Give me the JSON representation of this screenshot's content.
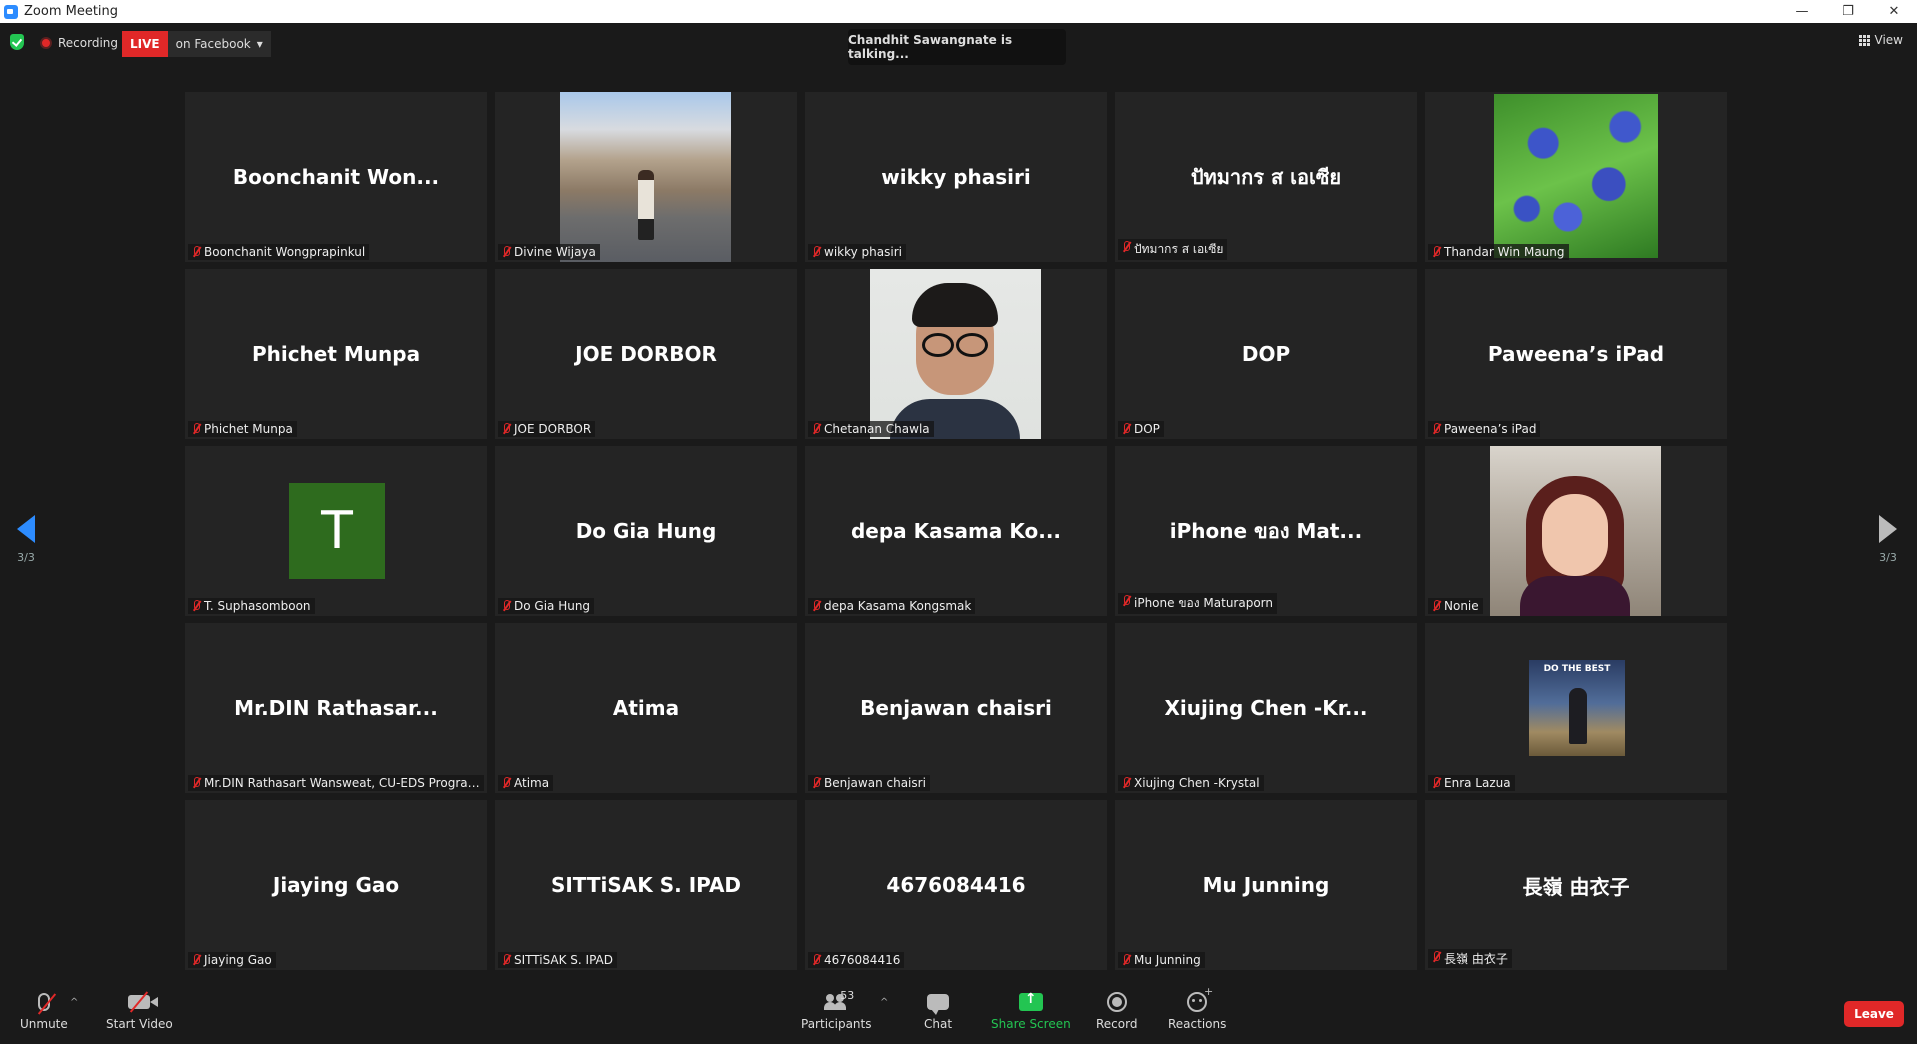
{
  "window": {
    "title": "Zoom Meeting",
    "controls": [
      "—",
      "❐",
      "✕"
    ]
  },
  "topbar": {
    "recording_label": "Recording",
    "live_label": "LIVE",
    "live_destination": "on Facebook",
    "talking": "Chandhit Sawangnate is talking...",
    "view_label": "View"
  },
  "pagination": {
    "left": "3/3",
    "right": "3/3"
  },
  "tiles": [
    {
      "display": "Boonchanit  Won...",
      "label": "Boonchanit Wongprapinkul",
      "type": "name"
    },
    {
      "display": "",
      "label": "Divine Wijaya",
      "type": "photo",
      "photo": "pic-prague"
    },
    {
      "display": "wikky phasiri",
      "label": "wikky phasiri",
      "type": "name"
    },
    {
      "display": "ปัทมากร   ส เอเซีย",
      "label": "ปัทมากร   ส เอเซีย",
      "type": "name"
    },
    {
      "display": "",
      "label": "Thandar Win Maung",
      "type": "photo",
      "photo": "pic-flowers"
    },
    {
      "display": "Phichet Munpa",
      "label": "Phichet Munpa",
      "type": "name"
    },
    {
      "display": "JOE DORBOR",
      "label": "JOE DORBOR",
      "type": "name"
    },
    {
      "display": "",
      "label": "Chetanan Chawla",
      "type": "photo",
      "photo": "pic-portrait"
    },
    {
      "display": "DOP",
      "label": "DOP",
      "type": "name"
    },
    {
      "display": "Paweena’s iPad",
      "label": "Paweena’s iPad",
      "type": "name"
    },
    {
      "display": "T",
      "label": "T. Suphasomboon",
      "type": "avatar"
    },
    {
      "display": "Do Gia Hung",
      "label": "Do Gia Hung",
      "type": "name"
    },
    {
      "display": "depa Kasama Ko...",
      "label": "depa Kasama Kongsmak",
      "type": "name"
    },
    {
      "display": "iPhone ของ Mat...",
      "label": "iPhone ของ Maturaporn",
      "type": "name"
    },
    {
      "display": "",
      "label": "Nonie",
      "type": "photo",
      "photo": "pic-selfie"
    },
    {
      "display": "Mr.DIN  Rathasar...",
      "label": "Mr.DIN Rathasart Wansweat, CU-EDS Program...",
      "type": "name"
    },
    {
      "display": "Atima",
      "label": "Atima",
      "type": "name"
    },
    {
      "display": "Benjawan chaisri",
      "label": "Benjawan chaisri",
      "type": "name"
    },
    {
      "display": "Xiujing  Chen  -Kr...",
      "label": "Xiujing Chen -Krystal",
      "type": "name"
    },
    {
      "display": "DO THE BEST",
      "label": "Enra Lazua",
      "type": "poster"
    },
    {
      "display": "Jiaying Gao",
      "label": "Jiaying Gao",
      "type": "name"
    },
    {
      "display": "SITTiSAK S. IPAD",
      "label": "SITTiSAK S. IPAD",
      "type": "name"
    },
    {
      "display": "4676084416",
      "label": "4676084416",
      "type": "name"
    },
    {
      "display": "Mu Junning",
      "label": "Mu Junning",
      "type": "name"
    },
    {
      "display": "長嶺 由衣子",
      "label": "長嶺 由衣子",
      "type": "name"
    }
  ],
  "toolbar": {
    "unmute": "Unmute",
    "start_video": "Start Video",
    "participants": "Participants",
    "participants_count": "53",
    "chat": "Chat",
    "share_screen": "Share Screen",
    "record": "Record",
    "reactions": "Reactions",
    "leave": "Leave"
  },
  "colors": {
    "accent": "#2D8CFF",
    "live": "#e02828",
    "share": "#23c552",
    "tile_bg": "#242424",
    "stage_bg": "#1a1a1a"
  }
}
